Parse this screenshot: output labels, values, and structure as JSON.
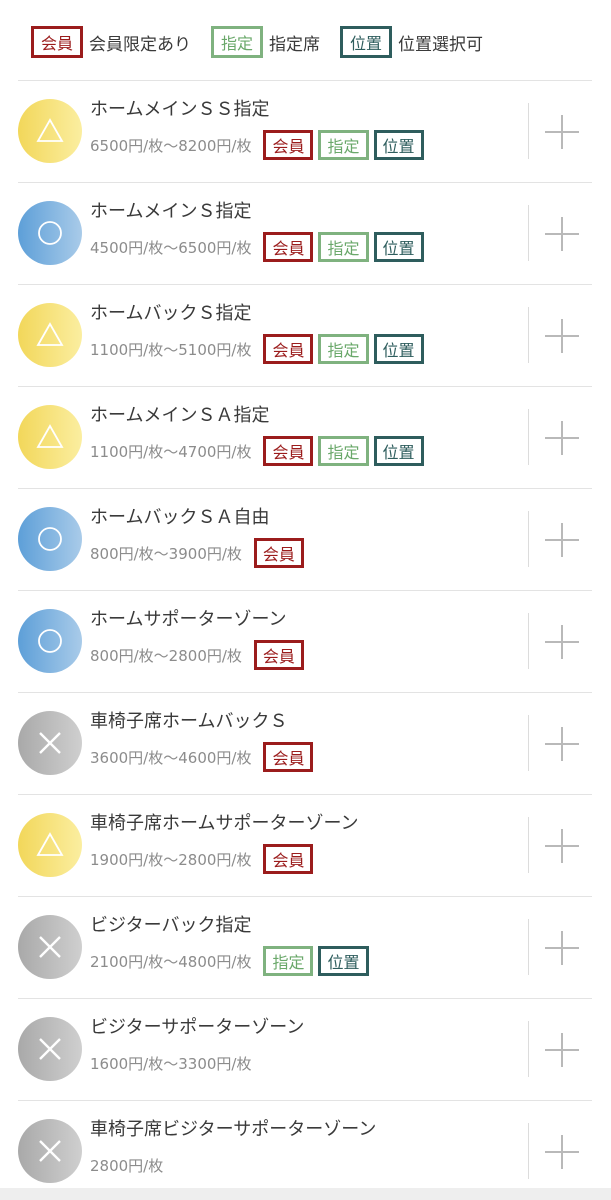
{
  "legend": {
    "member_badge": "会員",
    "member_label": "会員限定あり",
    "reserved_badge": "指定",
    "reserved_label": "指定席",
    "position_badge": "位置",
    "position_label": "位置選択可"
  },
  "colors": {
    "member": "#9b1c1c",
    "reserved": "#7fb27f",
    "position": "#2e5d5d",
    "triangle": "#f2d75a",
    "circle": "#5d9fd8",
    "cross": "#a9a9a9"
  },
  "seats": [
    {
      "name": "ホームメインＳＳ指定",
      "price": "6500円/枚〜8200円/枚",
      "status": "triangle",
      "status_symbol": "△",
      "badges": [
        "会員",
        "指定",
        "位置"
      ]
    },
    {
      "name": "ホームメインＳ指定",
      "price": "4500円/枚〜6500円/枚",
      "status": "circle",
      "status_symbol": "○",
      "badges": [
        "会員",
        "指定",
        "位置"
      ]
    },
    {
      "name": "ホームバックＳ指定",
      "price": "1100円/枚〜5100円/枚",
      "status": "triangle",
      "status_symbol": "△",
      "badges": [
        "会員",
        "指定",
        "位置"
      ]
    },
    {
      "name": "ホームメインＳＡ指定",
      "price": "1100円/枚〜4700円/枚",
      "status": "triangle",
      "status_symbol": "△",
      "badges": [
        "会員",
        "指定",
        "位置"
      ]
    },
    {
      "name": "ホームバックＳＡ自由",
      "price": "800円/枚〜3900円/枚",
      "status": "circle",
      "status_symbol": "○",
      "badges": [
        "会員"
      ]
    },
    {
      "name": "ホームサポーターゾーン",
      "price": "800円/枚〜2800円/枚",
      "status": "circle",
      "status_symbol": "○",
      "badges": [
        "会員"
      ]
    },
    {
      "name": "車椅子席ホームバックＳ",
      "price": "3600円/枚〜4600円/枚",
      "status": "cross",
      "status_symbol": "✕",
      "badges": [
        "会員"
      ]
    },
    {
      "name": "車椅子席ホームサポーターゾーン",
      "price": "1900円/枚〜2800円/枚",
      "status": "triangle",
      "status_symbol": "△",
      "badges": [
        "会員"
      ]
    },
    {
      "name": "ビジターバック指定",
      "price": "2100円/枚〜4800円/枚",
      "status": "cross",
      "status_symbol": "✕",
      "badges": [
        "指定",
        "位置"
      ]
    },
    {
      "name": "ビジターサポーターゾーン",
      "price": "1600円/枚〜3300円/枚",
      "status": "cross",
      "status_symbol": "✕",
      "badges": []
    },
    {
      "name": "車椅子席ビジターサポーターゾーン",
      "price": "2800円/枚",
      "status": "cross",
      "status_symbol": "✕",
      "badges": []
    }
  ]
}
